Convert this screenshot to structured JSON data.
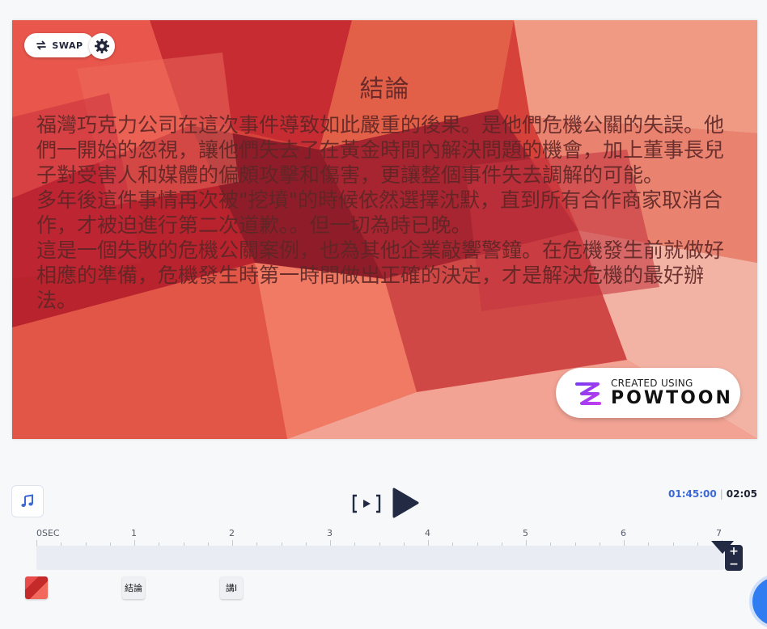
{
  "slide": {
    "title": "結論",
    "paragraphs": [
      "福灣巧克力公司在這次事件導致如此嚴重的後果。是他們危機公關的失誤。他們一開始的忽視，讓他們失去了在黃金時間內解決問題的機會，加上董事長兒子對受害人和媒體的偏頗攻擊和傷害，更讓整個事件失去調解的可能。",
      "多年後這件事情再次被\"挖墳\"的時候依然選擇沈默，直到所有合作商家取消合作，才被迫進行第二次道歉。。但一切為時已晚。",
      "這是一個失敗的危機公關案例，也為其他企業敲響警鐘。在危機發生前就做好相應的準備，危機發生時第一時間做出正確的決定，才是解決危機的最好辦法。"
    ],
    "colors": {
      "background": "#d33a35",
      "text": "#5e2626"
    }
  },
  "controls": {
    "swap_label": "SWAP",
    "swap_icon": "swap-arrows-icon",
    "settings_icon": "gear-icon"
  },
  "badge": {
    "small": "CREATED USING",
    "big": "POWTOON"
  },
  "player": {
    "music_icon": "music-note-icon",
    "frame_icon": "frame-play-icon",
    "play_icon": "play-icon",
    "current_time": "01:45:00",
    "total_time": "02:05",
    "accent": "#3c67d6"
  },
  "timeline": {
    "ticks": [
      "0SEC",
      "1",
      "2",
      "3",
      "4",
      "5",
      "6",
      "7"
    ],
    "thumbs": [
      {
        "label": "",
        "kind": "image"
      },
      {
        "label": "結論",
        "kind": "text"
      },
      {
        "label": "講I",
        "kind": "text"
      }
    ]
  }
}
